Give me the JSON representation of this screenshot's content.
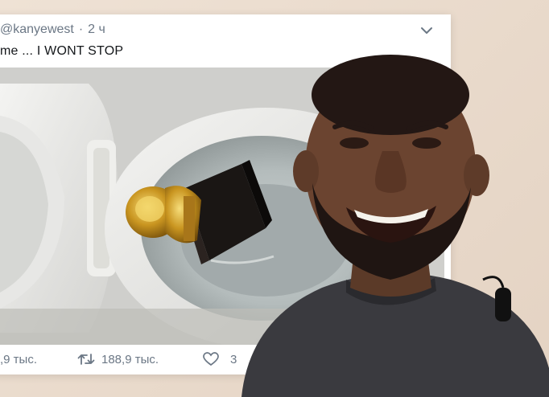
{
  "tweet": {
    "handle": "@kanyewest",
    "separator": "·",
    "time": "2 ч",
    "text": "me ... I WONT STOP",
    "menu_icon": "chevron-down-icon",
    "actions": {
      "reply": {
        "icon": "reply-icon",
        "count": ",9 тыс."
      },
      "retweet": {
        "icon": "retweet-icon",
        "count": "188,9 тыс."
      },
      "like": {
        "icon": "heart-icon",
        "count": "3"
      }
    }
  },
  "colors": {
    "background": "#e8d9cb",
    "card": "#ffffff",
    "muted_text": "#6b7785",
    "text": "#14171a"
  }
}
